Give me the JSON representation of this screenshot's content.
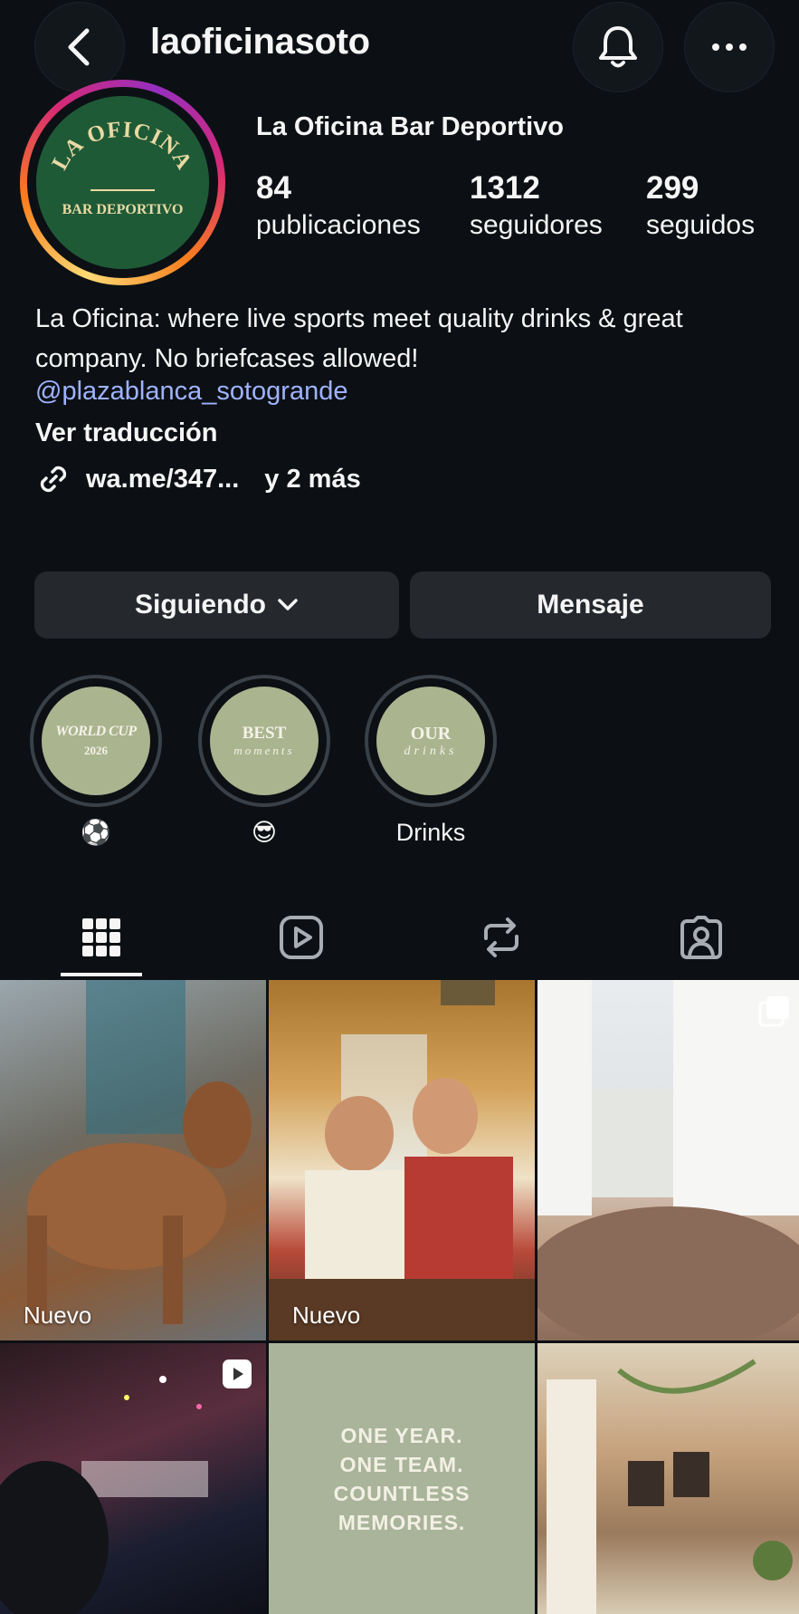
{
  "header": {
    "username": "laoficinasoto",
    "back_icon": "chevron-left-icon",
    "bell_icon": "bell-icon",
    "more_icon": "more-horizontal-icon"
  },
  "profile": {
    "display_name": "La Oficina Bar Deportivo",
    "avatar": {
      "line1": "LA OFICINA",
      "line2": "BAR DEPORTIVO",
      "bg_color": "#1f5a37",
      "text_color": "#e9d9a3"
    },
    "stats": [
      {
        "value": "84",
        "label": "publicaciones"
      },
      {
        "value": "1312",
        "label": "seguidores"
      },
      {
        "value": "299",
        "label": "seguidos"
      }
    ],
    "bio": "La Oficina: where live sports meet quality drinks & great company. No briefcases allowed!",
    "mention": "@plazablanca_sotogrande",
    "translate": "Ver traducción",
    "link": "wa.me/347...",
    "more_links": "y 2 más"
  },
  "buttons": {
    "following": "Siguiendo",
    "message": "Mensaje"
  },
  "highlights": [
    {
      "line1": "WORLD CUP",
      "line2": "2026",
      "label": "⚽"
    },
    {
      "line1": "BEST",
      "line2": "moments",
      "label": "😎"
    },
    {
      "line1": "OUR",
      "line2": "drinks",
      "label": "Drinks"
    }
  ],
  "tabs": [
    {
      "icon": "grid-icon",
      "active": true
    },
    {
      "icon": "reels-icon",
      "active": false
    },
    {
      "icon": "reposts-icon",
      "active": false
    },
    {
      "icon": "tagged-icon",
      "active": false
    }
  ],
  "grid": {
    "new_label": "Nuevo",
    "quote": [
      "ONE YEAR.",
      "ONE TEAM.",
      "COUNTLESS MEMORIES."
    ]
  },
  "colors": {
    "background": "#0c1014",
    "button_bg": "#25292e",
    "mention": "#9fb3ff",
    "highlight_bg": "#aab48f"
  }
}
